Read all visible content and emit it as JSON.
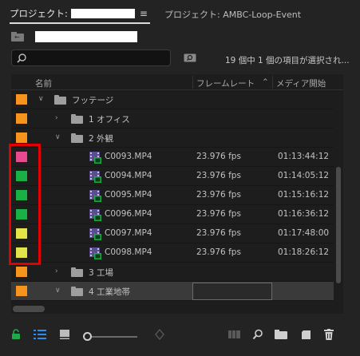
{
  "tabs": {
    "active_label": "プロジェクト: ",
    "other_label": "プロジェクト: AMBC-Loop-Event"
  },
  "search": {
    "placeholder": ""
  },
  "status_text": "19 個中 1 個の項目が選択され...",
  "columns": {
    "name": "名前",
    "frame_rate": "フレームレート",
    "media_start": "メディア開始"
  },
  "rows": [
    {
      "name": "フッテージ",
      "fps": "",
      "start": "",
      "type": "folder",
      "level": 0,
      "expanded": true,
      "swatch": "#f7941d"
    },
    {
      "name": "1 オフィス",
      "fps": "",
      "start": "",
      "type": "folder",
      "level": 1,
      "expanded": false,
      "swatch": "#f7941d"
    },
    {
      "name": "2 外観",
      "fps": "",
      "start": "",
      "type": "folder",
      "level": 1,
      "expanded": true,
      "swatch": "#f7941d"
    },
    {
      "name": "C0093.MP4",
      "fps": "23.976 fps",
      "start": "01:13:44:12",
      "type": "clip",
      "level": 2,
      "swatch": "#e84a8f"
    },
    {
      "name": "C0094.MP4",
      "fps": "23.976 fps",
      "start": "01:14:05:12",
      "type": "clip",
      "level": 2,
      "swatch": "#19b046"
    },
    {
      "name": "C0095.MP4",
      "fps": "23.976 fps",
      "start": "01:15:16:12",
      "type": "clip",
      "level": 2,
      "swatch": "#19b046"
    },
    {
      "name": "C0096.MP4",
      "fps": "23.976 fps",
      "start": "01:16:36:12",
      "type": "clip",
      "level": 2,
      "swatch": "#19b046"
    },
    {
      "name": "C0097.MP4",
      "fps": "23.976 fps",
      "start": "01:17:48:00",
      "type": "clip",
      "level": 2,
      "swatch": "#e3e34a"
    },
    {
      "name": "C0098.MP4",
      "fps": "23.976 fps",
      "start": "01:18:26:12",
      "type": "clip",
      "level": 2,
      "swatch": "#e3e34a"
    },
    {
      "name": "3 工場",
      "fps": "",
      "start": "",
      "type": "folder",
      "level": 1,
      "expanded": false,
      "swatch": "#f7941d"
    },
    {
      "name": "4 工業地帯",
      "fps": "",
      "start": "",
      "type": "folder",
      "level": 1,
      "expanded": true,
      "swatch": "#f7941d",
      "selected": true
    }
  ],
  "colors": {
    "accent": "#2d8ceb",
    "lock_green": "#1fa84a",
    "highlight_red": "#e30000"
  }
}
